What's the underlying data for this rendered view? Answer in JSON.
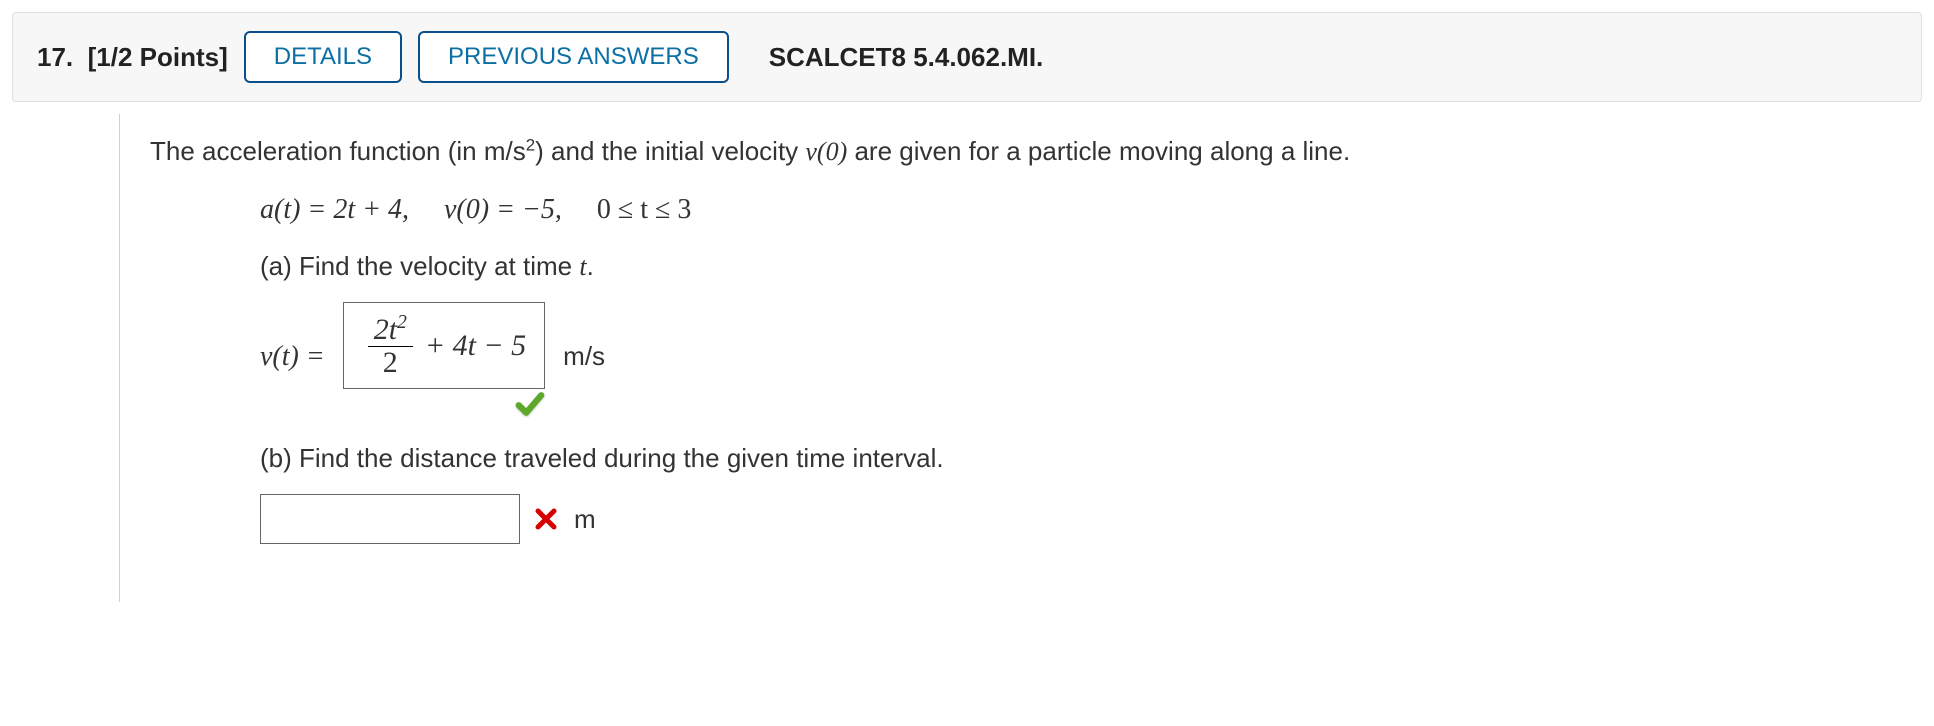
{
  "header": {
    "number_label": "17.",
    "points_label": "[1/2 Points]",
    "details_button": "DETAILS",
    "previous_button": "PREVIOUS ANSWERS",
    "ref_code": "SCALCET8 5.4.062.MI."
  },
  "prompt": {
    "intro_pre": "The acceleration function (in m/s",
    "intro_sup": "2",
    "intro_post": ") and the initial velocity ",
    "intro_v0": "v(0)",
    "intro_tail": " are given for a particle moving along a line."
  },
  "given": {
    "a_t_lhs": "a(t) = 2t + 4,",
    "v0": "v(0) = −5,",
    "interval": "0 ≤ t ≤ 3"
  },
  "part_a": {
    "label": "(a) Find the velocity at time ",
    "label_var": "t",
    "label_post": ".",
    "lhs": "v(t) = ",
    "answer_frac_num": "2t",
    "answer_frac_num_sup": "2",
    "answer_frac_den": "2",
    "answer_rest": " + 4t − 5",
    "unit": "m/s",
    "status": "correct"
  },
  "part_b": {
    "label": "(b) Find the distance traveled during the given time interval.",
    "answer_value": "",
    "unit": "m",
    "status": "incorrect"
  }
}
